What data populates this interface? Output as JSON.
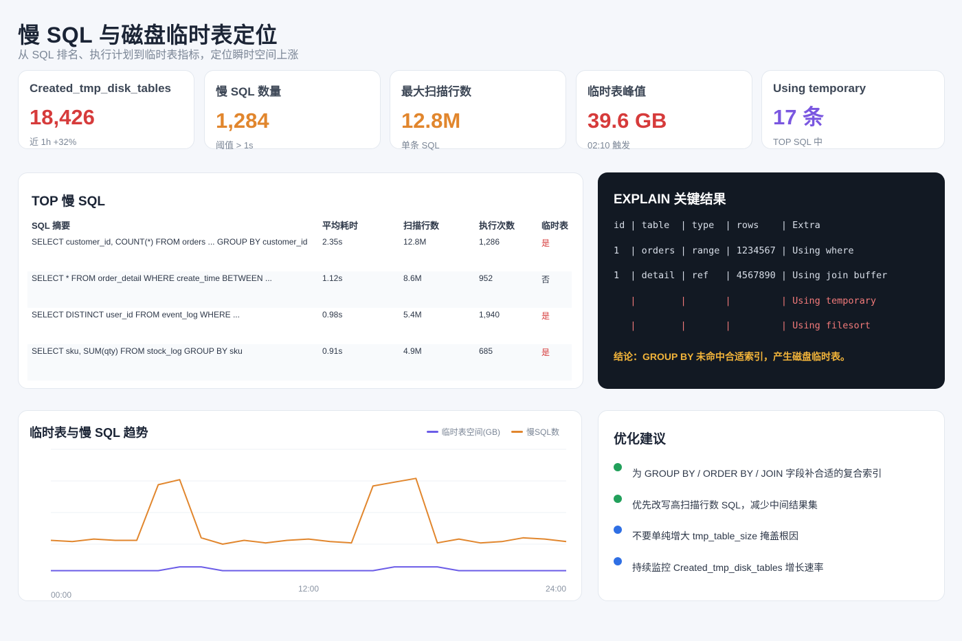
{
  "header": {
    "title": "慢 SQL 与磁盘临时表定位",
    "subtitle": "从 SQL 排名、执行计划到临时表指标，定位瞬时空间上涨"
  },
  "kpis": [
    {
      "label": "Created_tmp_disk_tables",
      "value": "18,426",
      "note": "近 1h +32%",
      "color": "#d63b3b"
    },
    {
      "label": "慢 SQL 数量",
      "value": "1,284",
      "note": "阈值 > 1s",
      "color": "#e1862d"
    },
    {
      "label": "最大扫描行数",
      "value": "12.8M",
      "note": "单条 SQL",
      "color": "#e1862d"
    },
    {
      "label": "临时表峰值",
      "value": "39.6 GB",
      "note": "02:10 触发",
      "color": "#d63b3b"
    },
    {
      "label": "Using temporary",
      "value": "17 条",
      "note": "TOP SQL 中",
      "color": "#7a57e0"
    }
  ],
  "top_sql": {
    "title": "TOP 慢 SQL",
    "columns": [
      "SQL 摘要",
      "平均耗时",
      "扫描行数",
      "执行次数",
      "临时表"
    ],
    "rows": [
      {
        "sql": "SELECT customer_id, COUNT(*) FROM orders ... GROUP BY customer_id",
        "avg": "2.35s",
        "scan": "12.8M",
        "exec": "1,286",
        "tmp": "是"
      },
      {
        "sql": "SELECT * FROM order_detail WHERE create_time BETWEEN ...",
        "avg": "1.12s",
        "scan": "8.6M",
        "exec": "952",
        "tmp": "否"
      },
      {
        "sql": "SELECT DISTINCT user_id FROM event_log WHERE ...",
        "avg": "0.98s",
        "scan": "5.4M",
        "exec": "1,940",
        "tmp": "是"
      },
      {
        "sql": "SELECT sku, SUM(qty) FROM stock_log GROUP BY sku",
        "avg": "0.91s",
        "scan": "4.9M",
        "exec": "685",
        "tmp": "是"
      }
    ]
  },
  "explain": {
    "title": "EXPLAIN 关键结果",
    "lines": [
      "id | table  | type  | rows    | Extra",
      "1  | orders | range | 1234567 | Using where",
      "1  | detail | ref   | 4567890 | Using join buffer",
      "   |        |       |         | Using temporary",
      "   |        |       |         | Using filesort"
    ],
    "conclusion": "结论：GROUP BY 未命中合适索引，产生磁盘临时表。"
  },
  "trend": {
    "title": "临时表与慢 SQL 趋势",
    "x_tick_labels": [
      "00:00",
      "12:00",
      "24:00"
    ]
  },
  "chart_data": {
    "type": "line",
    "title": "临时表与慢 SQL 趋势",
    "x_ticks": [
      "00:00",
      "12:00",
      "24:00"
    ],
    "grid": true,
    "legend_position": "top-right",
    "y_range": [
      0,
      100
    ],
    "series": [
      {
        "name": "临时表空间(GB)",
        "color": "#6b5ce7",
        "values": [
          4,
          4,
          4,
          4,
          4,
          4,
          7,
          7,
          4,
          4,
          4,
          4,
          4,
          4,
          4,
          4,
          7,
          7,
          7,
          4,
          4,
          4,
          4,
          4,
          4
        ]
      },
      {
        "name": "慢SQL数",
        "color": "#e1862d",
        "values": [
          28,
          27,
          29,
          28,
          28,
          72,
          76,
          30,
          25,
          28,
          26,
          28,
          29,
          27,
          26,
          71,
          74,
          77,
          26,
          29,
          26,
          27,
          30,
          29,
          27
        ]
      }
    ]
  },
  "advice": {
    "title": "优化建议",
    "items": [
      {
        "text": "为 GROUP BY / ORDER BY / JOIN 字段补合适的复合索引",
        "color": "#22a05b"
      },
      {
        "text": "优先改写高扫描行数 SQL，减少中间结果集",
        "color": "#22a05b"
      },
      {
        "text": "不要单纯增大 tmp_table_size 掩盖根因",
        "color": "#2f6fe4"
      },
      {
        "text": "持续监控 Created_tmp_disk_tables 增长速率",
        "color": "#2f6fe4"
      }
    ]
  }
}
